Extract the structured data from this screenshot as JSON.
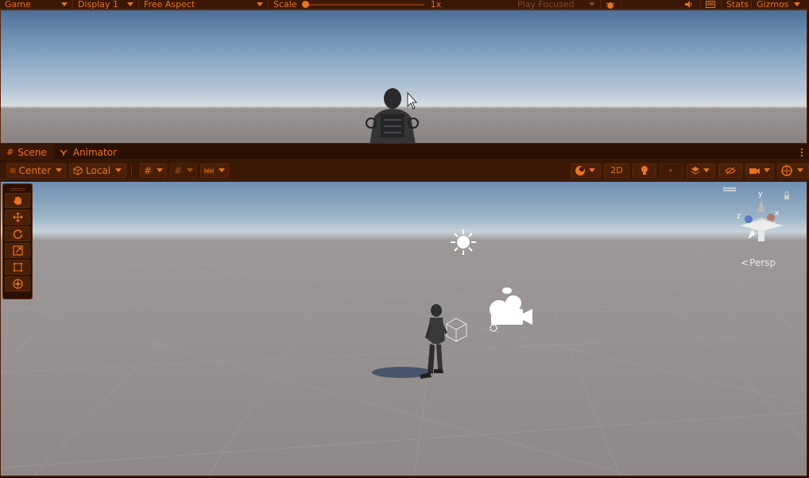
{
  "game_toolbar": {
    "tab": "Game",
    "display": "Display 1",
    "aspect": "Free Aspect",
    "scale_label": "Scale",
    "scale_value": "1x",
    "play_mode": "Play Focused",
    "stats": "Stats",
    "gizmos": "Gizmos"
  },
  "dock_tabs": {
    "scene": "Scene",
    "animator": "Animator"
  },
  "scene_toolbar": {
    "pivot": "Center",
    "space": "Local",
    "mode_2d": "2D"
  },
  "scene_gizmo": {
    "axis_y": "y",
    "axis_x": "x",
    "axis_z": "z",
    "projection": "Persp"
  },
  "colors": {
    "accent": "#e8731f",
    "toolbar_bg": "#3a1805"
  }
}
